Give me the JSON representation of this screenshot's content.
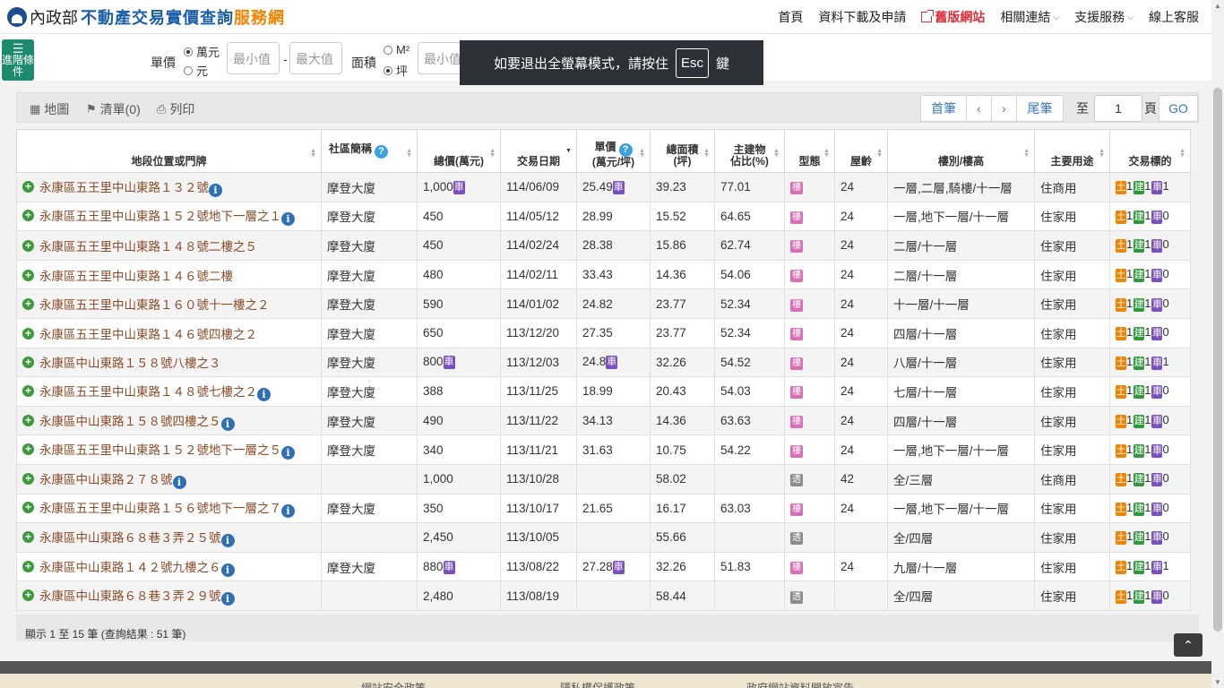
{
  "header": {
    "logo_ministry": "內政部",
    "logo_title": "不動產交易實價查詢",
    "logo_title_accent": "服務網",
    "nav": {
      "home": "首頁",
      "download": "資料下載及申請",
      "old_site": "舊版網站",
      "links": "相關連結",
      "support": "支援服務",
      "service": "線上客服"
    }
  },
  "filters": {
    "advanced_label": "進階條件",
    "unit_price_label": "單價",
    "unit_opt1": "萬元",
    "unit_opt2": "元",
    "min_placeholder": "最小值",
    "max_placeholder": "最大值",
    "dash": "-",
    "area_label": "面積",
    "area_opt1": "M²",
    "area_opt2": "坪",
    "area_min_placeholder": "最小值"
  },
  "fullscreen_toast": {
    "before": "如要退出全螢幕模式，請按住",
    "key": "Esc",
    "after": "鍵"
  },
  "toolbar": {
    "map": "地圖",
    "list": "清單(0)",
    "print": "列印",
    "first": "首筆",
    "prev": "‹",
    "next": "›",
    "last": "尾筆",
    "goto_label": "至",
    "page_value": "1",
    "page_suffix": "頁",
    "go": "GO"
  },
  "table": {
    "headers": {
      "address": "地段位置或門牌",
      "community": "社區簡稱",
      "total": "總價(萬元)",
      "date": "交易日期",
      "unit_price_1": "單價",
      "unit_price_2": "(萬元/坪)",
      "area_1": "總面積",
      "area_2": "(坪)",
      "main_ratio_1": "主建物",
      "main_ratio_2": "佔比(%)",
      "type": "型態",
      "age": "屋齡",
      "floor": "樓別/樓高",
      "use": "主要用途",
      "target": "交易標的"
    },
    "rows": [
      {
        "address": "永康區五王里中山東路１３２號",
        "info": true,
        "community": "摩登大廈",
        "total": "1,000",
        "total_car": true,
        "date": "114/06/09",
        "unit": "25.49",
        "unit_car": true,
        "area": "39.23",
        "ratio": "77.01",
        "type": "樓",
        "age": "24",
        "floor": "一層,二層,騎樓/十一層",
        "use": "住商用",
        "land": "1",
        "bld": "1",
        "car": "1"
      },
      {
        "address": "永康區五王里中山東路１５２號地下一層之１",
        "info": true,
        "community": "摩登大廈",
        "total": "450",
        "total_car": false,
        "date": "114/05/12",
        "unit": "28.99",
        "unit_car": false,
        "area": "15.52",
        "ratio": "64.65",
        "type": "樓",
        "age": "24",
        "floor": "一層,地下一層/十一層",
        "use": "住家用",
        "land": "1",
        "bld": "1",
        "car": "0"
      },
      {
        "address": "永康區五王里中山東路１４８號二樓之５",
        "info": false,
        "community": "摩登大廈",
        "total": "450",
        "total_car": false,
        "date": "114/02/24",
        "unit": "28.38",
        "unit_car": false,
        "area": "15.86",
        "ratio": "62.74",
        "type": "樓",
        "age": "24",
        "floor": "二層/十一層",
        "use": "住家用",
        "land": "1",
        "bld": "1",
        "car": "0"
      },
      {
        "address": "永康區五王里中山東路１４６號二樓",
        "info": false,
        "community": "摩登大廈",
        "total": "480",
        "total_car": false,
        "date": "114/02/11",
        "unit": "33.43",
        "unit_car": false,
        "area": "14.36",
        "ratio": "54.06",
        "type": "樓",
        "age": "24",
        "floor": "二層/十一層",
        "use": "住家用",
        "land": "1",
        "bld": "1",
        "car": "0"
      },
      {
        "address": "永康區五王里中山東路１６０號十一樓之２",
        "info": false,
        "community": "摩登大廈",
        "total": "590",
        "total_car": false,
        "date": "114/01/02",
        "unit": "24.82",
        "unit_car": false,
        "area": "23.77",
        "ratio": "52.34",
        "type": "樓",
        "age": "24",
        "floor": "十一層/十一層",
        "use": "住家用",
        "land": "1",
        "bld": "1",
        "car": "0"
      },
      {
        "address": "永康區五王里中山東路１４６號四樓之２",
        "info": false,
        "community": "摩登大廈",
        "total": "650",
        "total_car": false,
        "date": "113/12/20",
        "unit": "27.35",
        "unit_car": false,
        "area": "23.77",
        "ratio": "52.34",
        "type": "樓",
        "age": "24",
        "floor": "四層/十一層",
        "use": "住家用",
        "land": "1",
        "bld": "1",
        "car": "0"
      },
      {
        "address": "永康區中山東路１５８號八樓之３",
        "info": false,
        "community": "摩登大廈",
        "total": "800",
        "total_car": true,
        "date": "113/12/03",
        "unit": "24.8",
        "unit_car": true,
        "area": "32.26",
        "ratio": "54.52",
        "type": "樓",
        "age": "24",
        "floor": "八層/十一層",
        "use": "住家用",
        "land": "1",
        "bld": "1",
        "car": "1"
      },
      {
        "address": "永康區五王里中山東路１４８號七樓之２",
        "info": true,
        "community": "摩登大廈",
        "total": "388",
        "total_car": false,
        "date": "113/11/25",
        "unit": "18.99",
        "unit_car": false,
        "area": "20.43",
        "ratio": "54.03",
        "type": "樓",
        "age": "24",
        "floor": "七層/十一層",
        "use": "住家用",
        "land": "1",
        "bld": "1",
        "car": "0"
      },
      {
        "address": "永康區中山東路１５８號四樓之５",
        "info": true,
        "community": "摩登大廈",
        "total": "490",
        "total_car": false,
        "date": "113/11/22",
        "unit": "34.13",
        "unit_car": false,
        "area": "14.36",
        "ratio": "63.63",
        "type": "樓",
        "age": "24",
        "floor": "四層/十一層",
        "use": "住家用",
        "land": "1",
        "bld": "1",
        "car": "0"
      },
      {
        "address": "永康區五王里中山東路１５２號地下一層之５",
        "info": true,
        "community": "摩登大廈",
        "total": "340",
        "total_car": false,
        "date": "113/11/21",
        "unit": "31.63",
        "unit_car": false,
        "area": "10.75",
        "ratio": "54.22",
        "type": "樓",
        "age": "24",
        "floor": "一層,地下一層/十一層",
        "use": "住家用",
        "land": "1",
        "bld": "1",
        "car": "0"
      },
      {
        "address": "永康區中山東路２７８號",
        "info": true,
        "community": "",
        "total": "1,000",
        "total_car": false,
        "date": "113/10/28",
        "unit": "",
        "unit_car": false,
        "area": "58.02",
        "ratio": "",
        "type": "透",
        "age": "42",
        "floor": "全/三層",
        "use": "住商用",
        "land": "1",
        "bld": "1",
        "car": "0"
      },
      {
        "address": "永康區五王里中山東路１５６號地下一層之７",
        "info": true,
        "community": "摩登大廈",
        "total": "350",
        "total_car": false,
        "date": "113/10/17",
        "unit": "21.65",
        "unit_car": false,
        "area": "16.17",
        "ratio": "63.03",
        "type": "樓",
        "age": "24",
        "floor": "一層,地下一層/十一層",
        "use": "住家用",
        "land": "1",
        "bld": "1",
        "car": "0"
      },
      {
        "address": "永康區中山東路６８巷３弄２５號",
        "info": true,
        "community": "",
        "total": "2,450",
        "total_car": false,
        "date": "113/10/05",
        "unit": "",
        "unit_car": false,
        "area": "55.66",
        "ratio": "",
        "type": "透",
        "age": "",
        "floor": "全/四層",
        "use": "住家用",
        "land": "1",
        "bld": "1",
        "car": "0"
      },
      {
        "address": "永康區中山東路１４２號九樓之６",
        "info": true,
        "community": "摩登大廈",
        "total": "880",
        "total_car": true,
        "date": "113/08/22",
        "unit": "27.28",
        "unit_car": true,
        "area": "32.26",
        "ratio": "51.83",
        "type": "樓",
        "age": "24",
        "floor": "九層/十一層",
        "use": "住家用",
        "land": "1",
        "bld": "1",
        "car": "1"
      },
      {
        "address": "永康區中山東路６８巷３弄２９號",
        "info": true,
        "community": "",
        "total": "2,480",
        "total_car": false,
        "date": "113/08/19",
        "unit": "",
        "unit_car": false,
        "area": "58.44",
        "ratio": "",
        "type": "透",
        "age": "",
        "floor": "全/四層",
        "use": "住家用",
        "land": "1",
        "bld": "1",
        "car": "0"
      }
    ],
    "badge_car": "車",
    "tag_land": "土",
    "tag_bld": "建",
    "tag_car": "車"
  },
  "results_text": "顯示 1 至 15 筆 (查詢結果 : 51 筆)",
  "footer": {
    "link1": "網站安全政策",
    "link2": "隱私權保護政策",
    "link3": "政府網站資料開放宣告"
  }
}
